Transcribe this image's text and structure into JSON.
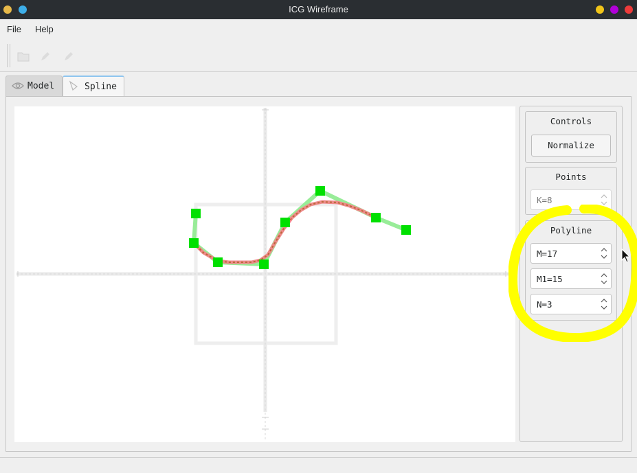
{
  "window": {
    "title": "ICG Wireframe",
    "buttons_left": [
      "app-icon",
      "pin-icon"
    ],
    "buttons_right": [
      "minimize-icon",
      "maximize-icon",
      "close-icon"
    ]
  },
  "menu": {
    "items": [
      "File",
      "Help"
    ]
  },
  "toolbar": {
    "icons": [
      "open-folder-icon",
      "edit-pencil-icon",
      "edit-pencil-icon"
    ]
  },
  "tabs": [
    {
      "label": "Model",
      "icon": "eye-icon",
      "active": false
    },
    {
      "label": "Spline",
      "icon": "spline-icon",
      "active": true
    }
  ],
  "panel": {
    "controls": {
      "title": "Controls",
      "normalize_label": "Normalize"
    },
    "points": {
      "title": "Points",
      "k_value": "K=8"
    },
    "polyline": {
      "title": "Polyline",
      "m_value": "M=17",
      "m1_value": "M1=15",
      "n_value": "N=3"
    }
  },
  "colors": {
    "control_point": "#00e000",
    "control_polyline": "#90ee90",
    "spline": "#ef8080",
    "annotation": "#ffff00"
  }
}
